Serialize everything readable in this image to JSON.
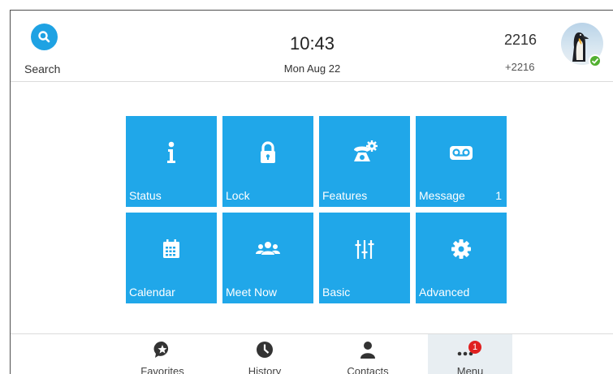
{
  "header": {
    "search_label": "Search",
    "time": "10:43",
    "date": "Mon Aug 22",
    "account_number": "2216",
    "account_ext": "+2216",
    "presence": "online"
  },
  "tiles": [
    {
      "label": "Status",
      "icon": "info-icon"
    },
    {
      "label": "Lock",
      "icon": "lock-icon"
    },
    {
      "label": "Features",
      "icon": "phone-gear-icon"
    },
    {
      "label": "Message",
      "icon": "voicemail-icon",
      "badge": "1"
    },
    {
      "label": "Calendar",
      "icon": "calendar-icon"
    },
    {
      "label": "Meet Now",
      "icon": "group-icon"
    },
    {
      "label": "Basic",
      "icon": "sliders-icon"
    },
    {
      "label": "Advanced",
      "icon": "gear-icon"
    }
  ],
  "nav": [
    {
      "label": "Favorites",
      "icon": "favorites-icon"
    },
    {
      "label": "History",
      "icon": "clock-icon"
    },
    {
      "label": "Contacts",
      "icon": "person-icon"
    },
    {
      "label": "Menu",
      "icon": "more-icon",
      "badge": "1",
      "active": true
    }
  ],
  "colors": {
    "accent": "#20a7e9",
    "badge": "#e02020",
    "presence": "#52b030"
  }
}
